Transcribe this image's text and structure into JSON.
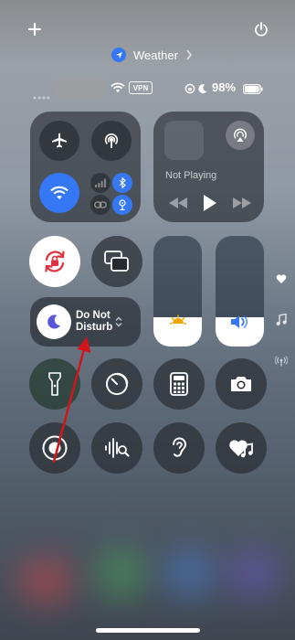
{
  "top": {
    "add_icon": "plus-icon",
    "power_icon": "power-icon",
    "location_app": "Weather"
  },
  "status_bar": {
    "vpn_label": "VPN",
    "battery_percent": "98%"
  },
  "media": {
    "status": "Not Playing"
  },
  "focus": {
    "label_line1": "Do Not",
    "label_line2": "Disturb"
  },
  "colors": {
    "accent_blue": "#3478f6",
    "arrow_red": "#d0161b"
  }
}
